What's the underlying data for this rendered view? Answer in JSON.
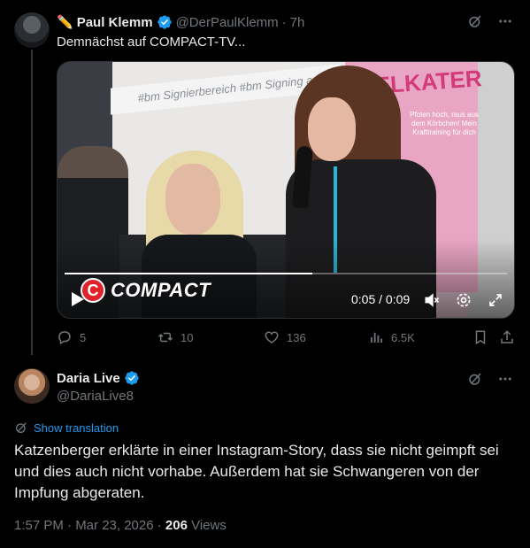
{
  "tweet1": {
    "author_name": "Paul Klemm",
    "author_emoji": "✏️",
    "handle": "@DerPaulKlemm",
    "separator": "·",
    "time_ago": "7h",
    "text": "Demnächst auf COMPACT-TV...",
    "video": {
      "overlay_logo_letter": "C",
      "overlay_logo_text": "COMPACT",
      "time_display": "0:05 / 0:09",
      "progress": 0.56,
      "scene_banner_text": "#bm Signierbereich #bm Signing area",
      "scene_poster_title": "KELKATER",
      "scene_poster_subtitle": "Pfoten hoch, raus aus dem Körbchen! Mein Krafttraining für dich"
    },
    "actions": {
      "replies": "5",
      "reposts": "10",
      "likes": "136",
      "views": "6.5K"
    }
  },
  "tweet2": {
    "author_name": "Daria Live",
    "handle": "@DariaLive8",
    "show_translation": "Show translation",
    "text": "Katzenberger erklärte in einer Instagram-Story, dass sie nicht geimpft sei und dies auch nicht vorhabe. Außerdem hat sie Schwangeren von der Impfung abgeraten.",
    "timestamp": "1:57 PM · Mar 23, 2026 · ",
    "views_count": "206",
    "views_label": " Views"
  },
  "colors": {
    "background": "#000000",
    "text": "#e7e9ea",
    "muted": "#71767b",
    "accent": "#1d9bf0",
    "verified": "#1d9bf0",
    "compact_red": "#e0232a"
  },
  "icons": [
    "grok-icon",
    "more-icon",
    "verified-badge-icon",
    "play-icon",
    "volume-muted-icon",
    "settings-icon",
    "fullscreen-icon",
    "reply-icon",
    "repost-icon",
    "like-icon",
    "views-icon",
    "bookmark-icon",
    "share-icon",
    "translate-icon"
  ]
}
